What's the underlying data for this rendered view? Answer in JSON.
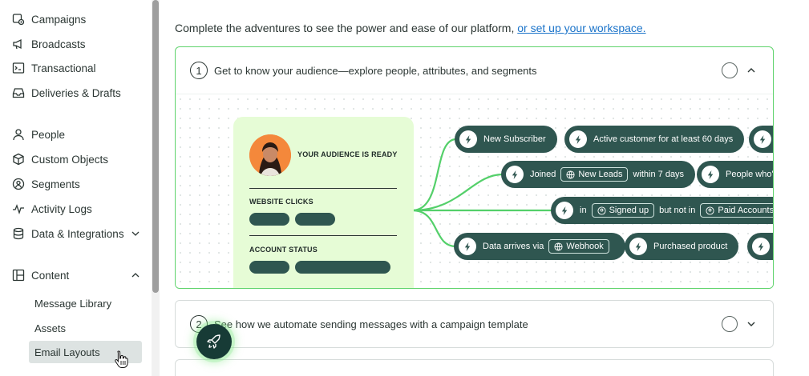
{
  "sidebar": {
    "items": [
      {
        "label": "Campaigns",
        "icon": "campaigns-icon"
      },
      {
        "label": "Broadcasts",
        "icon": "megaphone-icon"
      },
      {
        "label": "Transactional",
        "icon": "terminal-icon"
      },
      {
        "label": "Deliveries & Drafts",
        "icon": "inbox-icon"
      },
      {
        "label": "People",
        "icon": "person-icon"
      },
      {
        "label": "Custom Objects",
        "icon": "cube-icon"
      },
      {
        "label": "Segments",
        "icon": "segments-icon"
      },
      {
        "label": "Activity Logs",
        "icon": "activity-icon"
      },
      {
        "label": "Data & Integrations",
        "icon": "database-icon"
      },
      {
        "label": "Content",
        "icon": "layout-icon"
      }
    ],
    "content_subitems": [
      {
        "label": "Message Library"
      },
      {
        "label": "Assets"
      },
      {
        "label": "Email Layouts",
        "active": true
      }
    ]
  },
  "main": {
    "intro_text": "Complete the adventures to see the power and ease of our platform,",
    "intro_link": "or set up your workspace.",
    "steps": [
      {
        "number": "1",
        "title": "Get to know your audience—explore people, attributes, and segments",
        "expanded": true
      },
      {
        "number": "2",
        "title": "See how we automate sending messages with a campaign template",
        "expanded": false
      }
    ],
    "card": {
      "title": "YOUR AUDIENCE IS READY",
      "label1": "WEBSITE CLICKS",
      "label2": "ACCOUNT STATUS"
    },
    "tags": {
      "new_subscriber": "New Subscriber",
      "active_customer": "Active customer for at least 60 days",
      "joined": "Joined",
      "new_leads": "New Leads",
      "within": "within 7 days",
      "people_who": "People who'v",
      "in": "in",
      "signed_up": "Signed up",
      "but_not_in": "but not in",
      "paid_accounts": "Paid Accounts",
      "data_arrives": "Data arrives via",
      "webhook": "Webhook",
      "purchased": "Purchased product"
    }
  },
  "colors": {
    "accent_green": "#5fd36c",
    "tag_bg": "#2f5650",
    "card_bg": "#e6fcd6",
    "link": "#1a73c9"
  }
}
